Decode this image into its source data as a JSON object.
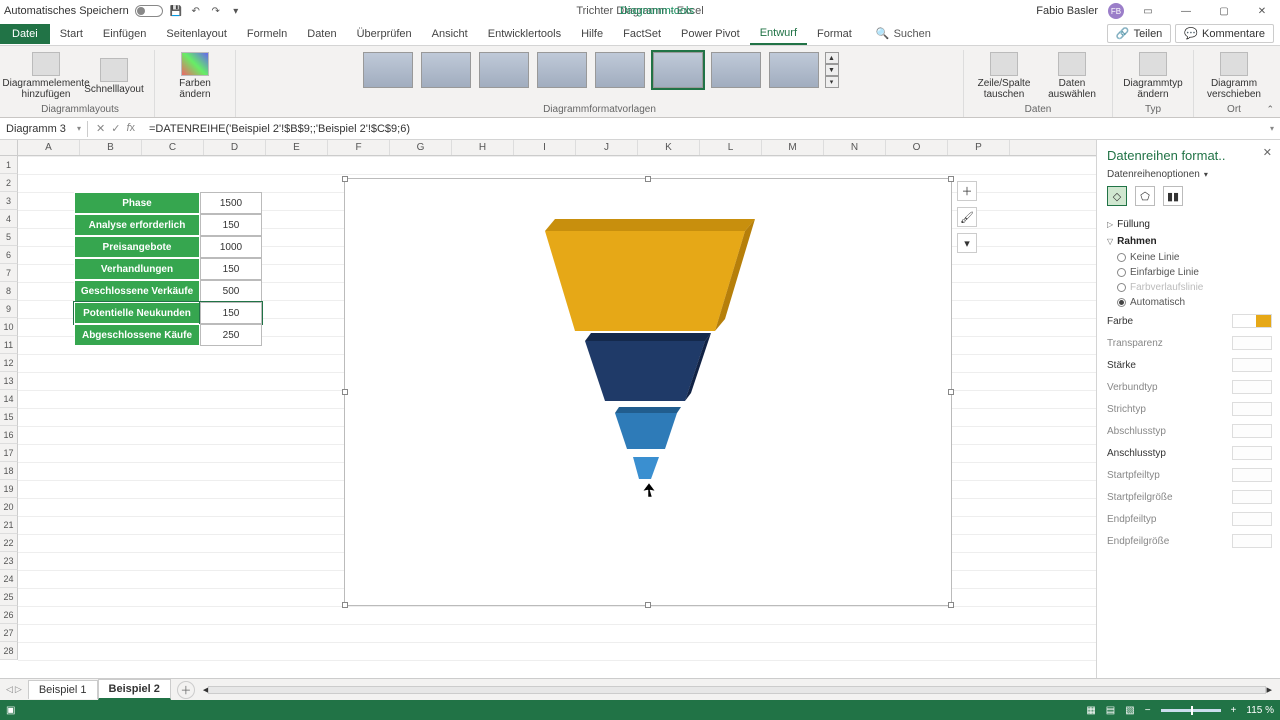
{
  "titlebar": {
    "autosave": "Automatisches Speichern",
    "doc_title": "Trichter Diagramm  -  Excel",
    "context_tool": "Diagrammtools",
    "user": "Fabio Basler",
    "user_initials": "FB"
  },
  "ribbon": {
    "tabs": [
      "Datei",
      "Start",
      "Einfügen",
      "Seitenlayout",
      "Formeln",
      "Daten",
      "Überprüfen",
      "Ansicht",
      "Entwicklertools",
      "Hilfe",
      "FactSet",
      "Power Pivot",
      "Entwurf",
      "Format"
    ],
    "active_tab": "Entwurf",
    "search": "Suchen",
    "share": "Teilen",
    "comments": "Kommentare",
    "groups": {
      "elements": "Diagrammelemente hinzufügen",
      "quick": "Schnelllayout",
      "colors": "Farben ändern",
      "layouts_label": "Diagrammlayouts",
      "styles_label": "Diagrammformatvorlagen",
      "switch": "Zeile/Spalte tauschen",
      "select": "Daten auswählen",
      "data_label": "Daten",
      "type": "Diagrammtyp ändern",
      "type_label": "Typ",
      "move": "Diagramm verschieben",
      "loc_label": "Ort"
    }
  },
  "name_box": "Diagramm 3",
  "formula": "=DATENREIHE('Beispiel 2'!$B$9;;'Beispiel 2'!$C$9;6)",
  "columns": [
    "A",
    "B",
    "C",
    "D",
    "E",
    "F",
    "G",
    "H",
    "I",
    "J",
    "K",
    "L",
    "M",
    "N",
    "O",
    "P"
  ],
  "row_count": 28,
  "table": {
    "header_a": "Phase",
    "header_b": "1500",
    "rows": [
      {
        "label": "Analyse erforderlich",
        "value": "150"
      },
      {
        "label": "Preisangebote",
        "value": "1000"
      },
      {
        "label": "Verhandlungen",
        "value": "150"
      },
      {
        "label": "Geschlossene Verkäufe",
        "value": "500"
      },
      {
        "label": "Potentielle Neukunden",
        "value": "150",
        "selected": true
      },
      {
        "label": "Abgeschlossene Käufe",
        "value": "250"
      }
    ]
  },
  "chart_data": {
    "type": "funnel-3d",
    "categories": [
      "Phase",
      "Analyse erforderlich",
      "Preisangebote",
      "Verhandlungen",
      "Geschlossene Verkäufe",
      "Potentielle Neukunden",
      "Abgeschlossene Käufe"
    ],
    "values": [
      1500,
      150,
      1000,
      150,
      500,
      150,
      250
    ],
    "colors": [
      "#e6a817",
      "#1f3a68",
      "#1f3a68",
      "#2e7bb8",
      "#2e7bb8",
      "#2e7bb8",
      "#2e7bb8"
    ]
  },
  "pane": {
    "title": "Datenreihen format..",
    "subtitle": "Datenreihenoptionen",
    "fill_section": "Füllung",
    "border_section": "Rahmen",
    "opts": {
      "none": "Keine Linie",
      "solid": "Einfarbige Linie",
      "gradient": "Farbverlaufslinie",
      "auto": "Automatisch"
    },
    "props": {
      "color": "Farbe",
      "trans": "Transparenz",
      "width": "Stärke",
      "compound": "Verbundtyp",
      "dash": "Strichtyp",
      "cap": "Abschlusstyp",
      "join": "Anschlusstyp",
      "begina": "Startpfeiltyp",
      "begins": "Startpfeilgröße",
      "enda": "Endpfeiltyp",
      "ends": "Endpfeilgröße"
    }
  },
  "sheets": {
    "s1": "Beispiel 1",
    "s2": "Beispiel 2"
  },
  "status": {
    "zoom": "115 %"
  }
}
